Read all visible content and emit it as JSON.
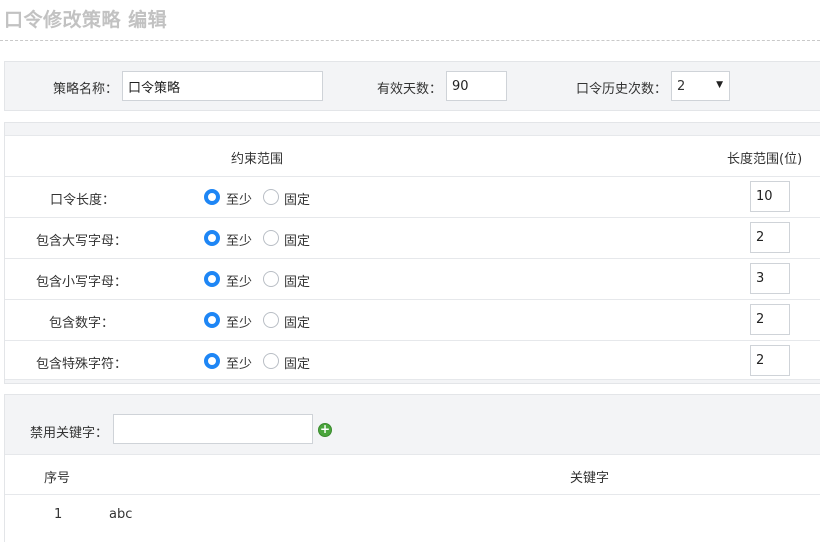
{
  "header": {
    "title": "口令修改策略 编辑"
  },
  "policy": {
    "name_label": "策略名称：",
    "name_value": "口令策略",
    "days_label": "有效天数：",
    "days_value": "90",
    "history_label": "口令历史次数：",
    "history_value": "2"
  },
  "constraints": {
    "col_constraint": "约束范围",
    "col_length": "长度范围(位)",
    "option_at_least": "至少",
    "option_fixed": "固定",
    "rows": [
      {
        "label": "口令长度：",
        "selected": "至少",
        "value": "10"
      },
      {
        "label": "包含大写字母：",
        "selected": "至少",
        "value": "2"
      },
      {
        "label": "包含小写字母：",
        "selected": "至少",
        "value": "3"
      },
      {
        "label": "包含数字：",
        "selected": "至少",
        "value": "2"
      },
      {
        "label": "包含特殊字符：",
        "selected": "至少",
        "value": "2"
      }
    ]
  },
  "keywords": {
    "label": "禁用关键字：",
    "input_value": "",
    "add_icon": "plus-circle-icon",
    "col_index": "序号",
    "col_keyword": "关键字",
    "items": [
      {
        "index": "1",
        "keyword": "abc"
      }
    ]
  },
  "colors": {
    "accent": "#1e86f5",
    "add": "#4aa53c",
    "title": "#c2c2c2"
  }
}
